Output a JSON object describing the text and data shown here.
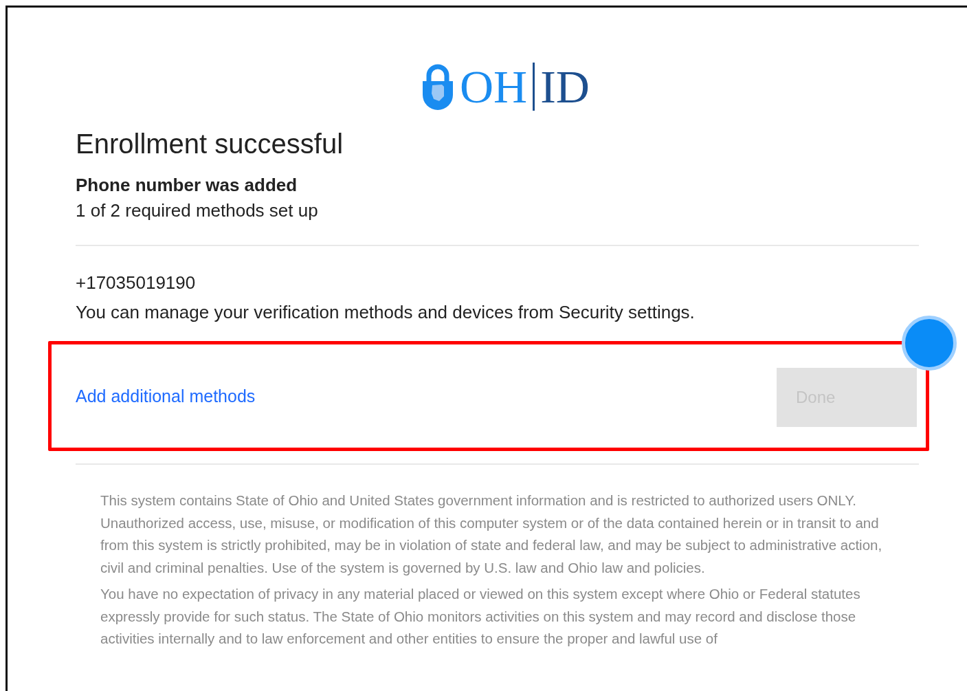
{
  "logo": {
    "left": "OH",
    "right": "ID"
  },
  "title": "Enrollment successful",
  "subtitle": "Phone number was added",
  "progress_text": "1 of 2 required methods set up",
  "phone": "+17035019190",
  "info": "You can manage your verification methods and devices from Security settings.",
  "actions": {
    "link": "Add additional methods",
    "button": {
      "label": "Done",
      "disabled": true
    },
    "highlighted": true
  },
  "disclaimer": [
    "This system contains State of Ohio and United States government information and is restricted to authorized users ONLY. Unauthorized access, use, misuse, or modification of this computer system or of the data contained herein or in transit to and from this system is strictly prohibited, may be in violation of state and federal law, and may be subject to administrative action, civil and criminal penalties. Use of the system is governed by U.S. law and Ohio law and policies.",
    "You have no expectation of privacy in any material placed or viewed on this system except where Ohio or Federal statutes expressly provide for such status. The State of Ohio monitors activities on this system and may record and disclose those activities internally and to law enforcement and other entities to ensure the proper and lawful use of"
  ]
}
